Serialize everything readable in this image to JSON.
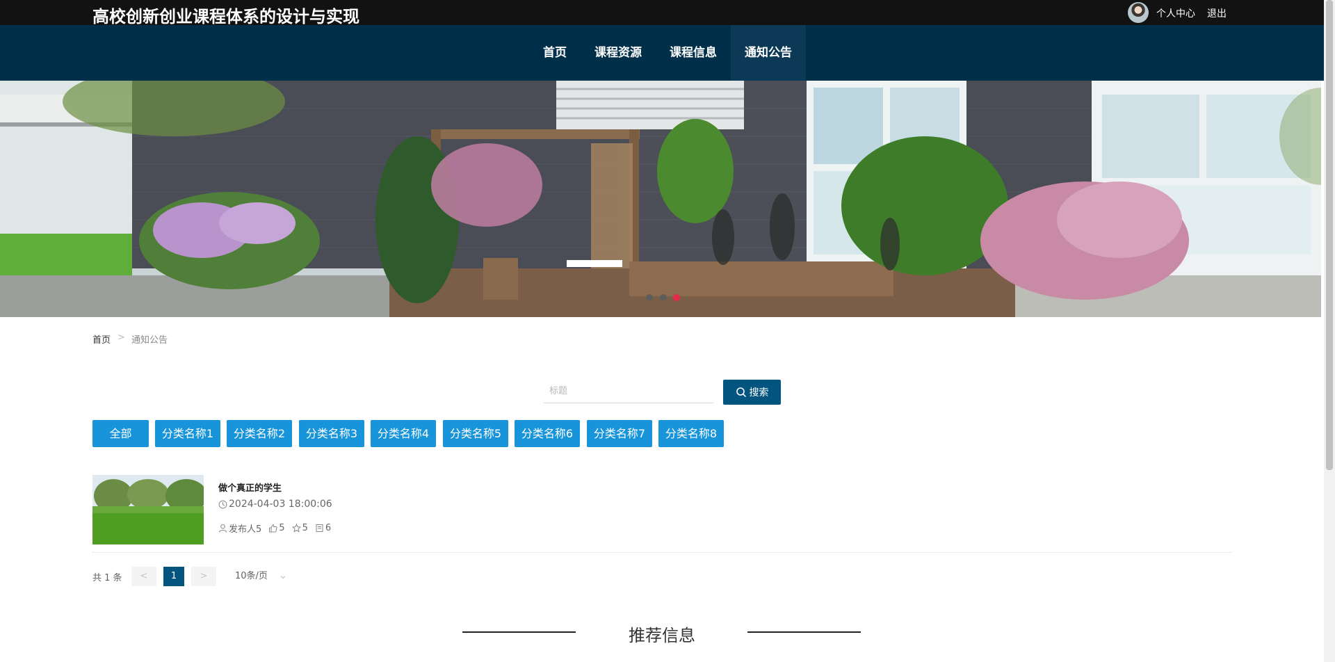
{
  "header": {
    "site_title": "高校创新创业课程体系的设计与实现",
    "user_center": "个人中心",
    "logout": "退出"
  },
  "nav": {
    "items": [
      {
        "label": "首页"
      },
      {
        "label": "课程资源"
      },
      {
        "label": "课程信息"
      },
      {
        "label": "通知公告"
      }
    ],
    "active_index": 3
  },
  "banner": {
    "slide_count": 3,
    "active_slide": 3
  },
  "breadcrumb": {
    "home": "首页",
    "separator": ">",
    "current": "通知公告"
  },
  "search": {
    "placeholder": "标题",
    "value": "",
    "button_label": "搜索"
  },
  "categories": {
    "items": [
      "全部",
      "分类名称1",
      "分类名称2",
      "分类名称3",
      "分类名称4",
      "分类名称5",
      "分类名称6",
      "分类名称7",
      "分类名称8"
    ]
  },
  "list": [
    {
      "title": "做个真正的学生",
      "time": "2024-04-03 18:00:06",
      "publisher": "发布人5",
      "likes": "5",
      "favorites": "5",
      "comments": "6"
    }
  ],
  "pagination": {
    "total_text": "共 1 条",
    "prev": "<",
    "current_page": "1",
    "next": ">",
    "page_size": "10条/页"
  },
  "recommend": {
    "title": "推荐信息"
  },
  "colors": {
    "top_bar": "#121212",
    "nav_bg": "#002f4a",
    "primary": "#03547f",
    "category_button": "#1794da"
  }
}
